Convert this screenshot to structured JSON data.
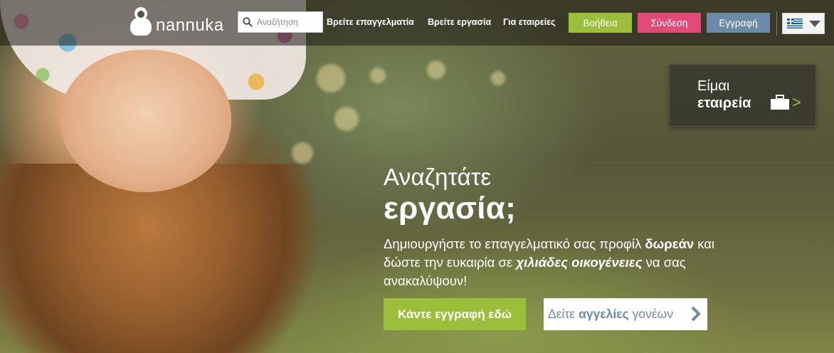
{
  "brand": {
    "name": "nannuka"
  },
  "search": {
    "placeholder": "Αναζήτηση"
  },
  "nav": {
    "links": [
      "Βρείτε επαγγελματία",
      "Βρείτε εργασία",
      "Για εταιρείες"
    ],
    "help": "Βοήθεια",
    "login": "Σύνδεση",
    "register": "Εγγραφή",
    "language": "greek-flag-icon"
  },
  "company_panel": {
    "line1": "Είμαι",
    "line2": "εταιρεία",
    "icon": "briefcase-icon",
    "chevron": ">"
  },
  "hero": {
    "heading_line1": "Αναζητάτε",
    "heading_line2": "εργασία;",
    "desc_part1": "Δημιουργήστε το επαγγελματικό σας προφίλ ",
    "desc_bold1": "δωρεάν",
    "desc_part2": " και δώστε την ευκαιρία σε ",
    "desc_bold2": "χιλιάδες οικογένειες",
    "desc_part3": " να σας ανακαλύψουν!",
    "cta_register": "Κάντε εγγραφή εδώ",
    "cta_ads_pre": "Δείτε",
    "cta_ads_bold": "αγγελίες",
    "cta_ads_post": "γονέων"
  },
  "colors": {
    "green": "#9bbf3a",
    "pink": "#e24b78",
    "blue": "#6a8aa5"
  }
}
